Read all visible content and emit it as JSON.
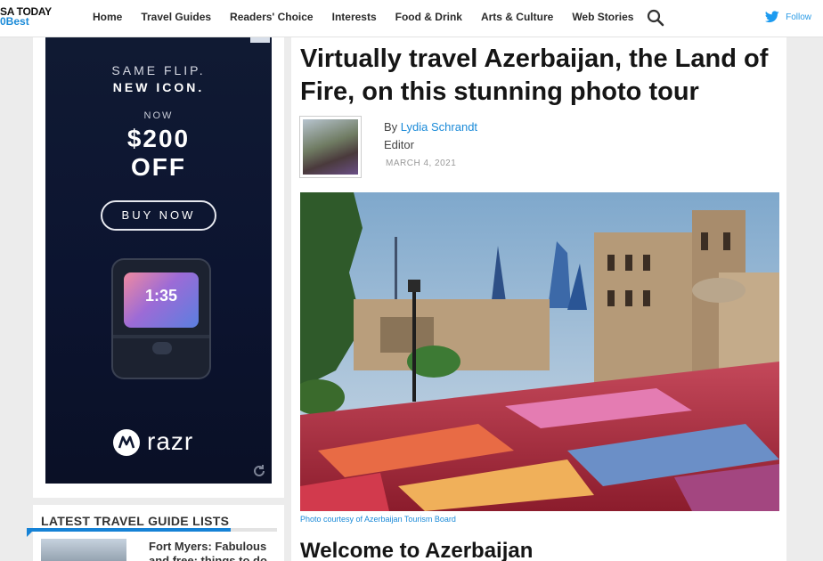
{
  "header": {
    "logo_line1": "SA TODAY",
    "logo_line2": "0Best",
    "nav": [
      "Home",
      "Travel Guides",
      "Readers' Choice",
      "Interests",
      "Food & Drink",
      "Arts & Culture",
      "Web Stories"
    ],
    "search_icon": "search-icon",
    "follow_label": "Follow",
    "twitter_icon": "twitter-icon",
    "accent_color": "#1a8ad8"
  },
  "ad": {
    "line1": "SAME FLIP.",
    "line2": "NEW ICON.",
    "now": "NOW",
    "price": "$200",
    "off": "OFF",
    "cta": "BUY NOW",
    "phone_time": "1:35",
    "brand": "razr",
    "background_color": "#0e1630"
  },
  "latest": {
    "title": "LATEST TRAVEL GUIDE LISTS",
    "items": [
      {
        "title": "Fort Myers: Fabulous and free: things to do"
      }
    ]
  },
  "article": {
    "headline": "Virtually travel Azerbaijan, the Land of Fire, on this stunning photo tour",
    "by_prefix": "By",
    "author": "Lydia Schrandt",
    "role": "Editor",
    "date": "MARCH 4, 2021",
    "photo_caption": "Photo courtesy of Azerbaijan Tourism Board",
    "section_heading": "Welcome to Azerbaijan"
  }
}
